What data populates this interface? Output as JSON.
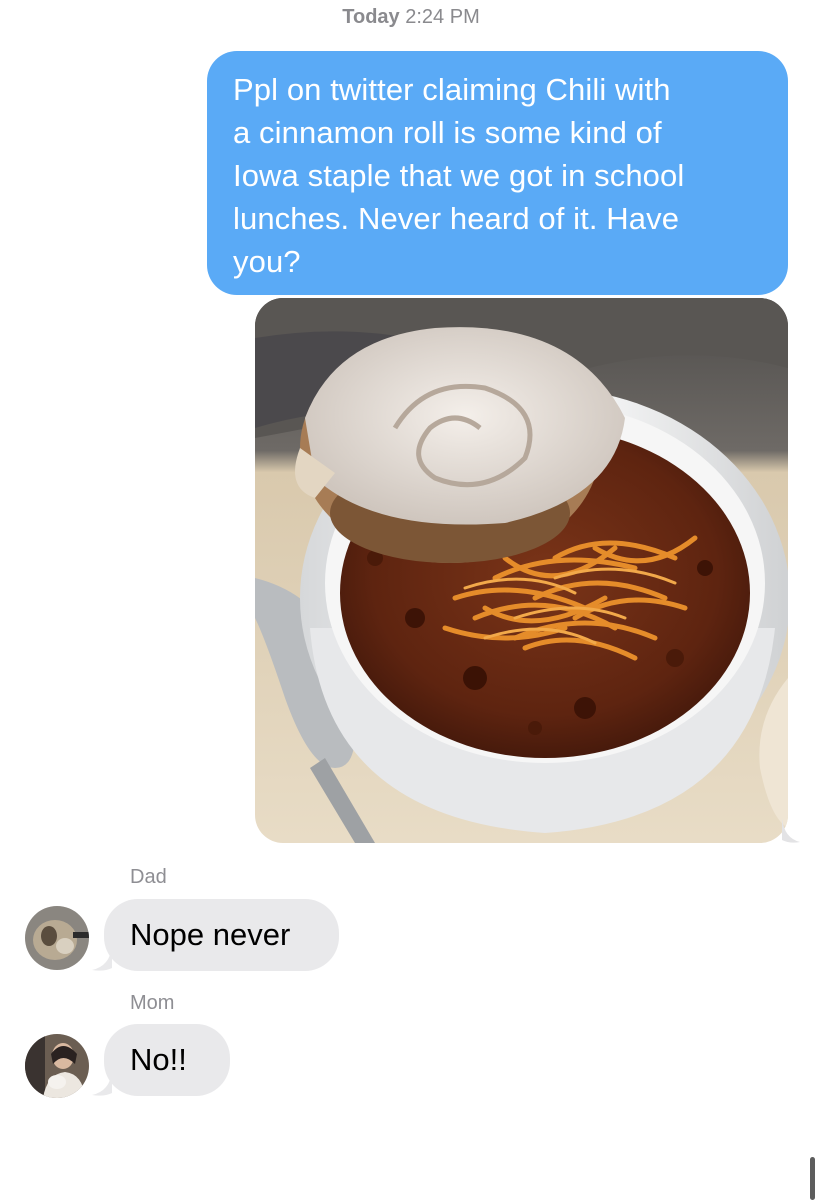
{
  "timestamp": {
    "day": "Today",
    "time": "2:24 PM"
  },
  "outgoing": {
    "text": "Ppl on twitter claiming Chili with a cinnamon roll is some kind of Iowa staple that we got in school lunches. Never heard of it. Have you?",
    "lines": [
      "Ppl on twitter claiming Chili with",
      "a cinnamon roll is some kind of",
      "Iowa staple that we got in school",
      "lunches. Never heard of it. Have",
      "you?"
    ],
    "photo_icon": "photo-chili-cinnamon-roll"
  },
  "replies": [
    {
      "sender": "Dad",
      "text": "Nope never",
      "avatar_icon": "dad-avatar-icon"
    },
    {
      "sender": "Mom",
      "text": "No!!",
      "avatar_icon": "mom-avatar-icon"
    }
  ],
  "colors": {
    "outgoing_bubble": "#5aaaf6",
    "incoming_bubble": "#e9e9eb",
    "meta_text": "#8a8a8e"
  }
}
